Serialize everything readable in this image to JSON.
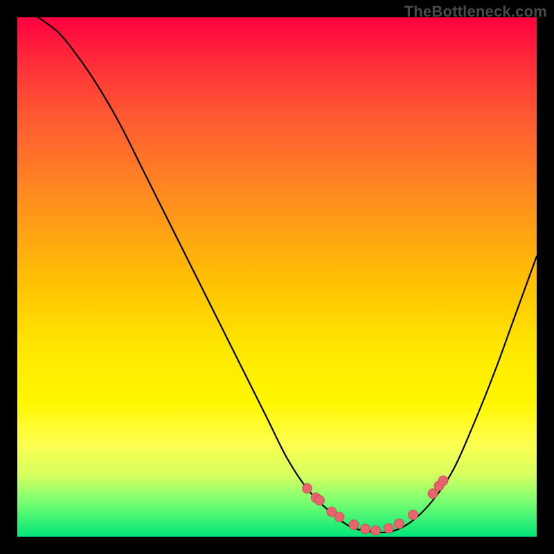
{
  "watermark": "TheBottleneck.com",
  "chart_data": {
    "type": "line",
    "title": "",
    "xlabel": "",
    "ylabel": "",
    "xlim": [
      0,
      100
    ],
    "ylim": [
      0,
      100
    ],
    "grid": false,
    "legend": false,
    "series": [
      {
        "name": "curve",
        "x": [
          4,
          8,
          12,
          16,
          20,
          24,
          28,
          32,
          36,
          40,
          44,
          48,
          52,
          56,
          60,
          64,
          68,
          72,
          76,
          80,
          84,
          88,
          92,
          96,
          100
        ],
        "y": [
          100,
          97,
          92,
          86,
          79,
          71,
          63,
          55,
          47,
          39,
          31,
          23,
          15,
          9,
          5,
          2,
          1,
          1,
          3,
          7,
          13,
          22,
          32,
          43,
          54
        ]
      }
    ],
    "markers": {
      "name": "highlight-points",
      "x": [
        55.8,
        57.5,
        58.2,
        60.5,
        62.0,
        64.8,
        67.0,
        69.0,
        71.5,
        73.5,
        76.2,
        80.0,
        81.2,
        82.0
      ],
      "y": [
        9.3,
        7.5,
        7.0,
        4.8,
        3.8,
        2.3,
        1.5,
        1.2,
        1.6,
        2.5,
        4.2,
        8.3,
        9.8,
        10.8
      ]
    },
    "background_gradient": {
      "top": "#ff0040",
      "bottom": "#00e67a"
    }
  }
}
